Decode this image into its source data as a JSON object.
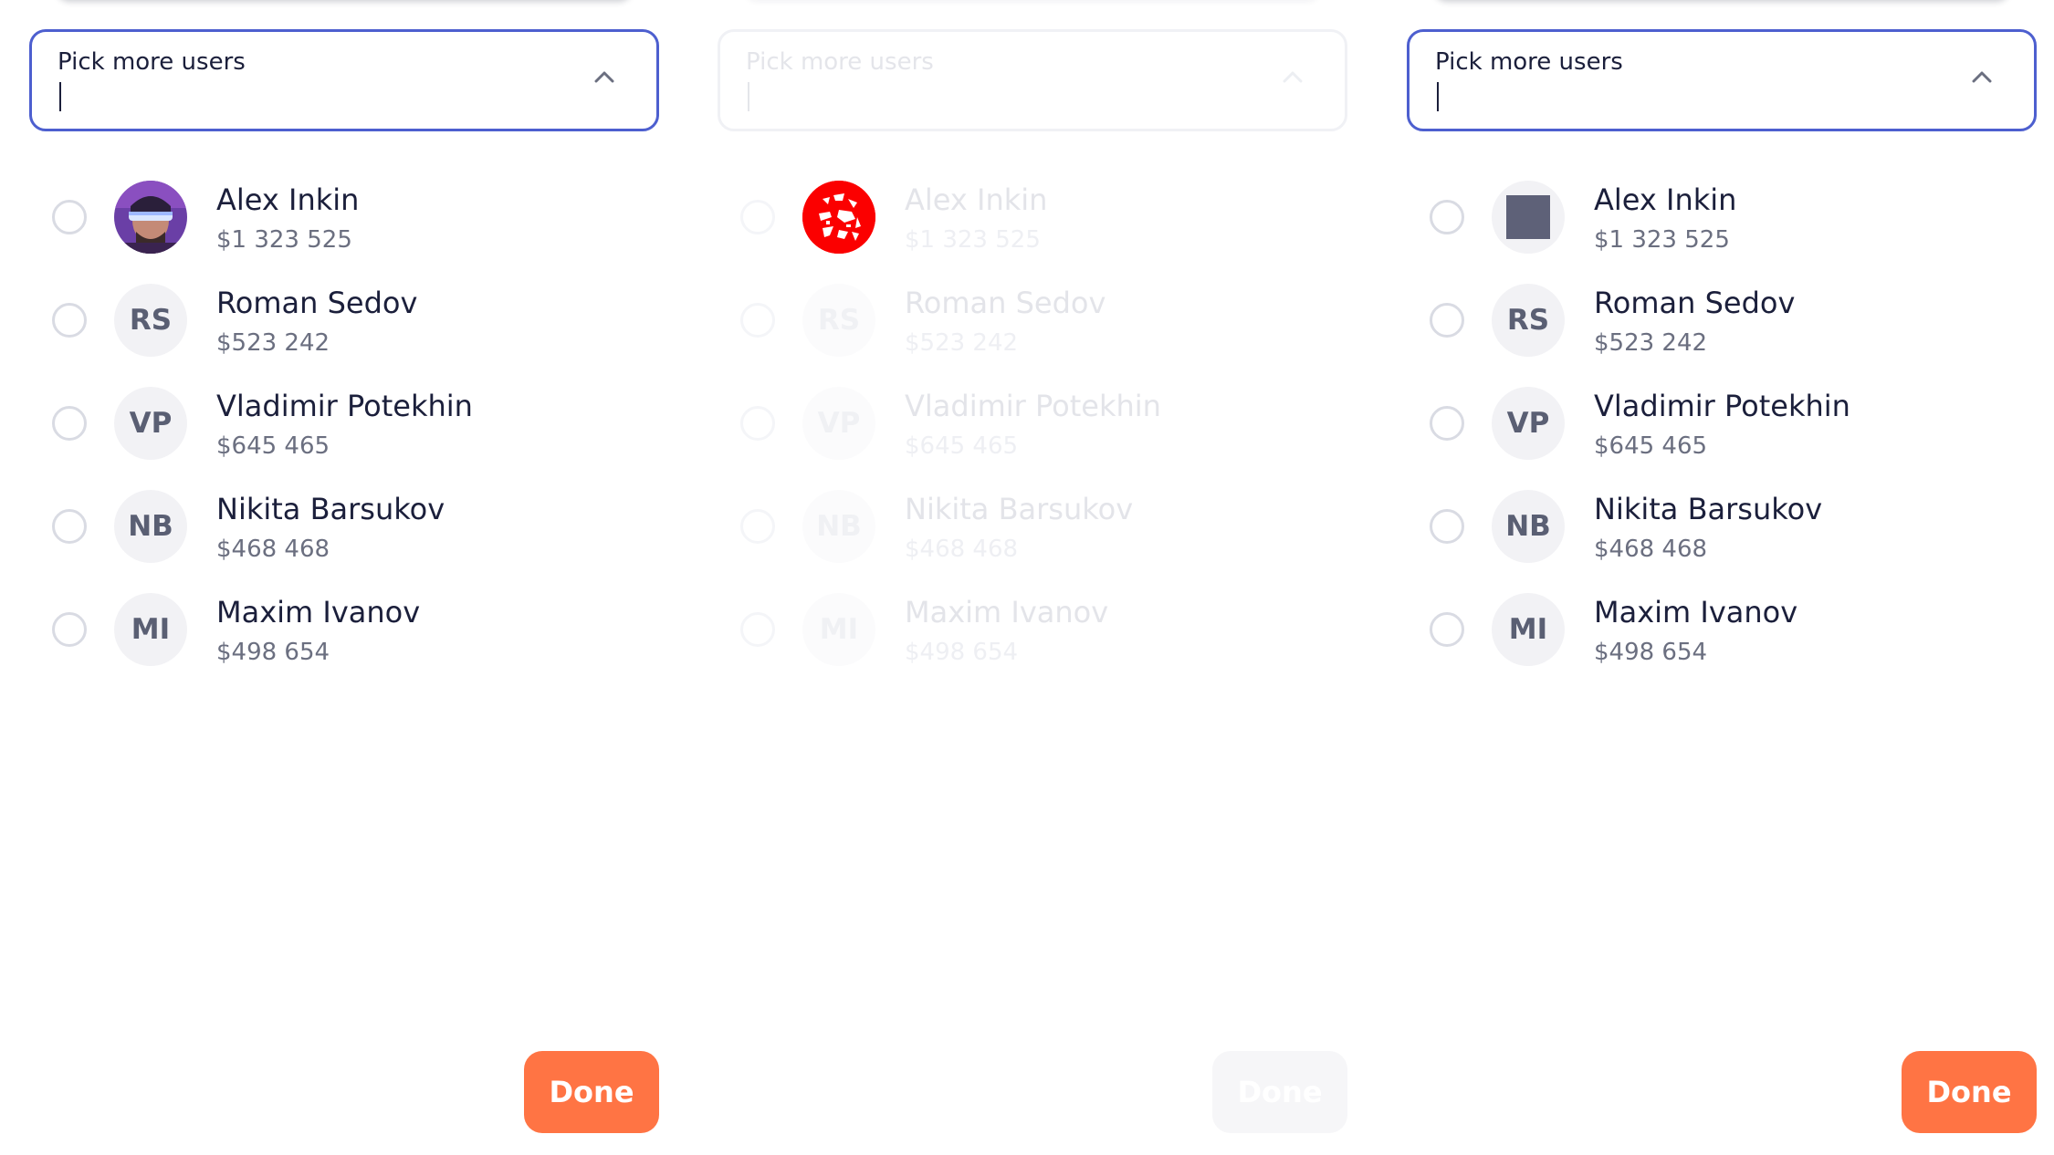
{
  "colors": {
    "focus_border": "#4d5fcf",
    "accent": "#ff7444",
    "text_primary": "#1b1f3b",
    "text_secondary": "#6b6f80",
    "avatar_bg": "#f2f2f5"
  },
  "panels": [
    {
      "state": "focused",
      "select": {
        "label": "Pick more users",
        "icon": "chevron-up-icon"
      },
      "first_avatar": "photo",
      "users": [
        {
          "name": "Alex Inkin",
          "amount": "$1 323 525",
          "initials": ""
        },
        {
          "name": "Roman Sedov",
          "amount": "$523 242",
          "initials": "RS"
        },
        {
          "name": "Vladimir Potekhin",
          "amount": "$645 465",
          "initials": "VP"
        },
        {
          "name": "Nikita Barsukov",
          "amount": "$468 468",
          "initials": "NB"
        },
        {
          "name": "Maxim Ivanov",
          "amount": "$498 654",
          "initials": "MI"
        }
      ],
      "done_label": "Done"
    },
    {
      "state": "disabled",
      "select": {
        "label": "Pick more users",
        "icon": "chevron-up-icon"
      },
      "first_avatar": "red-photo",
      "users": [
        {
          "name": "Alex Inkin",
          "amount": "$1 323 525",
          "initials": ""
        },
        {
          "name": "Roman Sedov",
          "amount": "$523 242",
          "initials": "RS"
        },
        {
          "name": "Vladimir Potekhin",
          "amount": "$645 465",
          "initials": "VP"
        },
        {
          "name": "Nikita Barsukov",
          "amount": "$468 468",
          "initials": "NB"
        },
        {
          "name": "Maxim Ivanov",
          "amount": "$498 654",
          "initials": "MI"
        }
      ],
      "done_label": "Done"
    },
    {
      "state": "focused",
      "select": {
        "label": "Pick more users",
        "icon": "chevron-up-icon"
      },
      "first_avatar": "placeholder-square",
      "users": [
        {
          "name": "Alex Inkin",
          "amount": "$1 323 525",
          "initials": ""
        },
        {
          "name": "Roman Sedov",
          "amount": "$523 242",
          "initials": "RS"
        },
        {
          "name": "Vladimir Potekhin",
          "amount": "$645 465",
          "initials": "VP"
        },
        {
          "name": "Nikita Barsukov",
          "amount": "$468 468",
          "initials": "NB"
        },
        {
          "name": "Maxim Ivanov",
          "amount": "$498 654",
          "initials": "MI"
        }
      ],
      "done_label": "Done"
    }
  ]
}
